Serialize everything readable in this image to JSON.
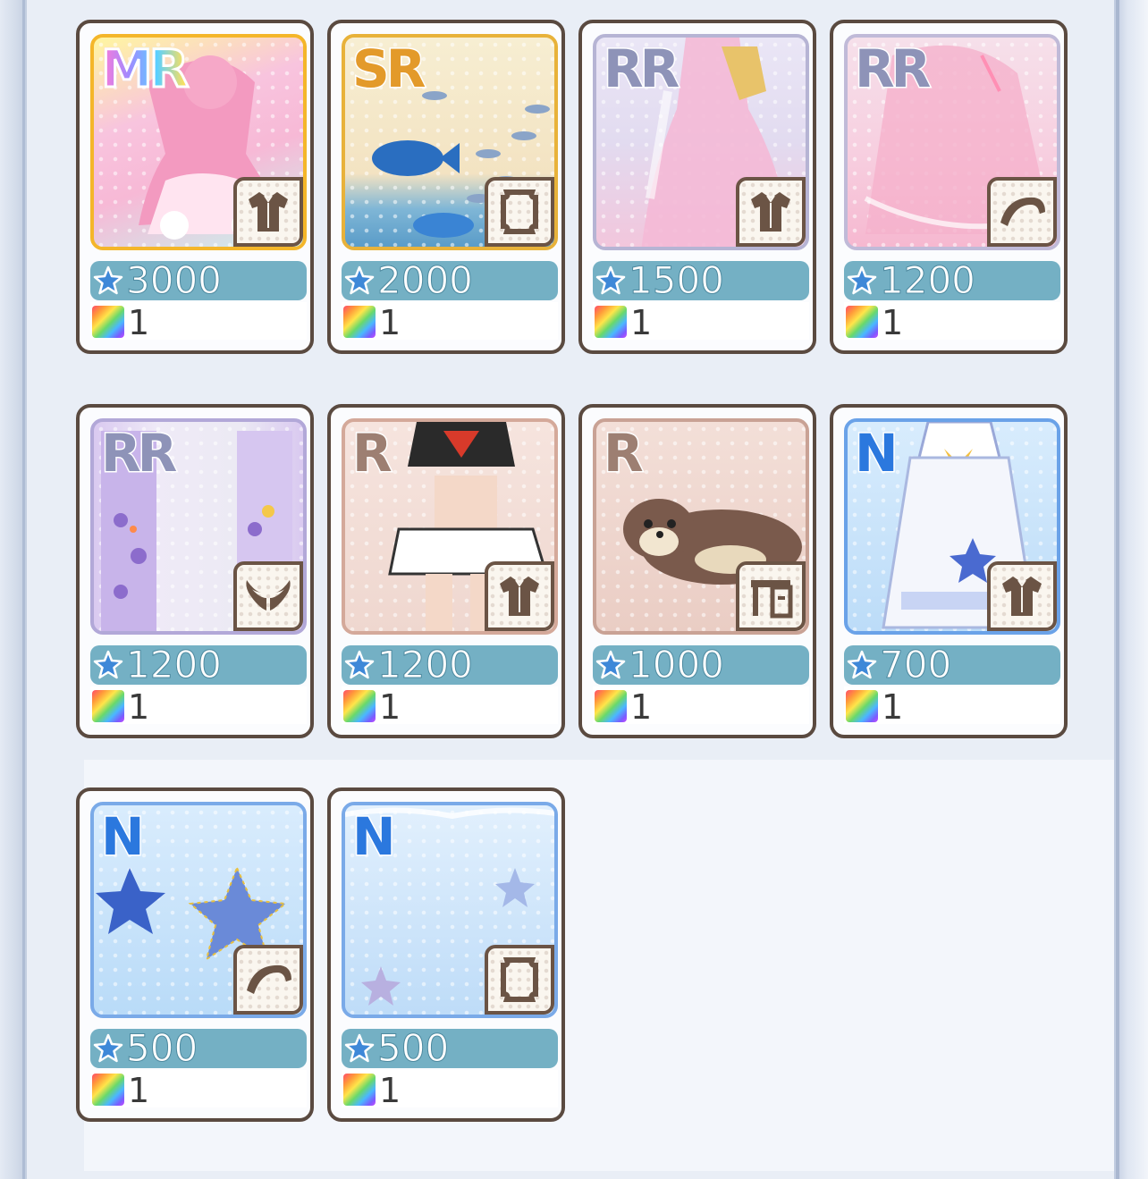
{
  "items": [
    {
      "rank": "MR",
      "category": "dress-icon",
      "price": "3000",
      "quantity": "1",
      "bg": "#f6c6dc"
    },
    {
      "rank": "SR",
      "category": "frame-icon",
      "price": "2000",
      "quantity": "1",
      "bg": "#f6ecd0"
    },
    {
      "rank": "RR",
      "category": "dress-icon",
      "price": "1500",
      "quantity": "1",
      "bg": "#e6e0f2"
    },
    {
      "rank": "RR",
      "category": "hair-icon",
      "price": "1200",
      "quantity": "1",
      "bg": "#f6dce6"
    },
    {
      "rank": "RR",
      "category": "wings-icon",
      "price": "1200",
      "quantity": "1",
      "bg": "#e4def0"
    },
    {
      "rank": "R",
      "category": "dress-icon",
      "price": "1200",
      "quantity": "1",
      "bg": "#f2ddd6"
    },
    {
      "rank": "R",
      "category": "furniture-icon",
      "price": "1000",
      "quantity": "1",
      "bg": "#eed8d0"
    },
    {
      "rank": "N",
      "category": "dress-icon",
      "price": "700",
      "quantity": "1",
      "bg": "#cfe6fb"
    },
    {
      "rank": "N",
      "category": "hair-icon",
      "price": "500",
      "quantity": "1",
      "bg": "#cfe6fb"
    },
    {
      "rank": "N",
      "category": "frame-icon",
      "price": "500",
      "quantity": "1",
      "bg": "#d3e8fb"
    }
  ],
  "colors": {
    "rank_MR": "#ff8ad8",
    "rank_SR": "#e8a030",
    "rank_RR": "#8a90b0",
    "rank_R": "#a08070",
    "rank_N": "#2a7ae0",
    "price_bar": "#74b0c4",
    "card_border": "#5a4a40"
  }
}
